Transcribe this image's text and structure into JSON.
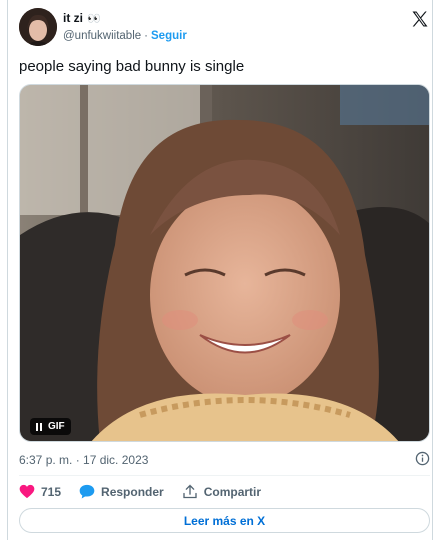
{
  "author": {
    "display_name": "it zi",
    "emoji": "👀",
    "handle": "@unfukwiitable",
    "separator": "·",
    "follow_label": "Seguir"
  },
  "tweet": {
    "text": "people saying bad bunny is single",
    "gif_label": "GIF",
    "timestamp": "6:37 p. m. · 17 dic. 2023"
  },
  "actions": {
    "like_count": "715",
    "reply_label": "Responder",
    "share_label": "Compartir"
  },
  "read_more_label": "Leer más en X",
  "colors": {
    "link_blue": "#1d9bf0",
    "like_pink": "#f91880",
    "reply_blue": "#1d9bf0",
    "muted": "#536471"
  },
  "icons": [
    "x-logo-icon",
    "info-icon",
    "heart-icon",
    "reply-bubble-icon",
    "share-icon",
    "pause-icon"
  ]
}
